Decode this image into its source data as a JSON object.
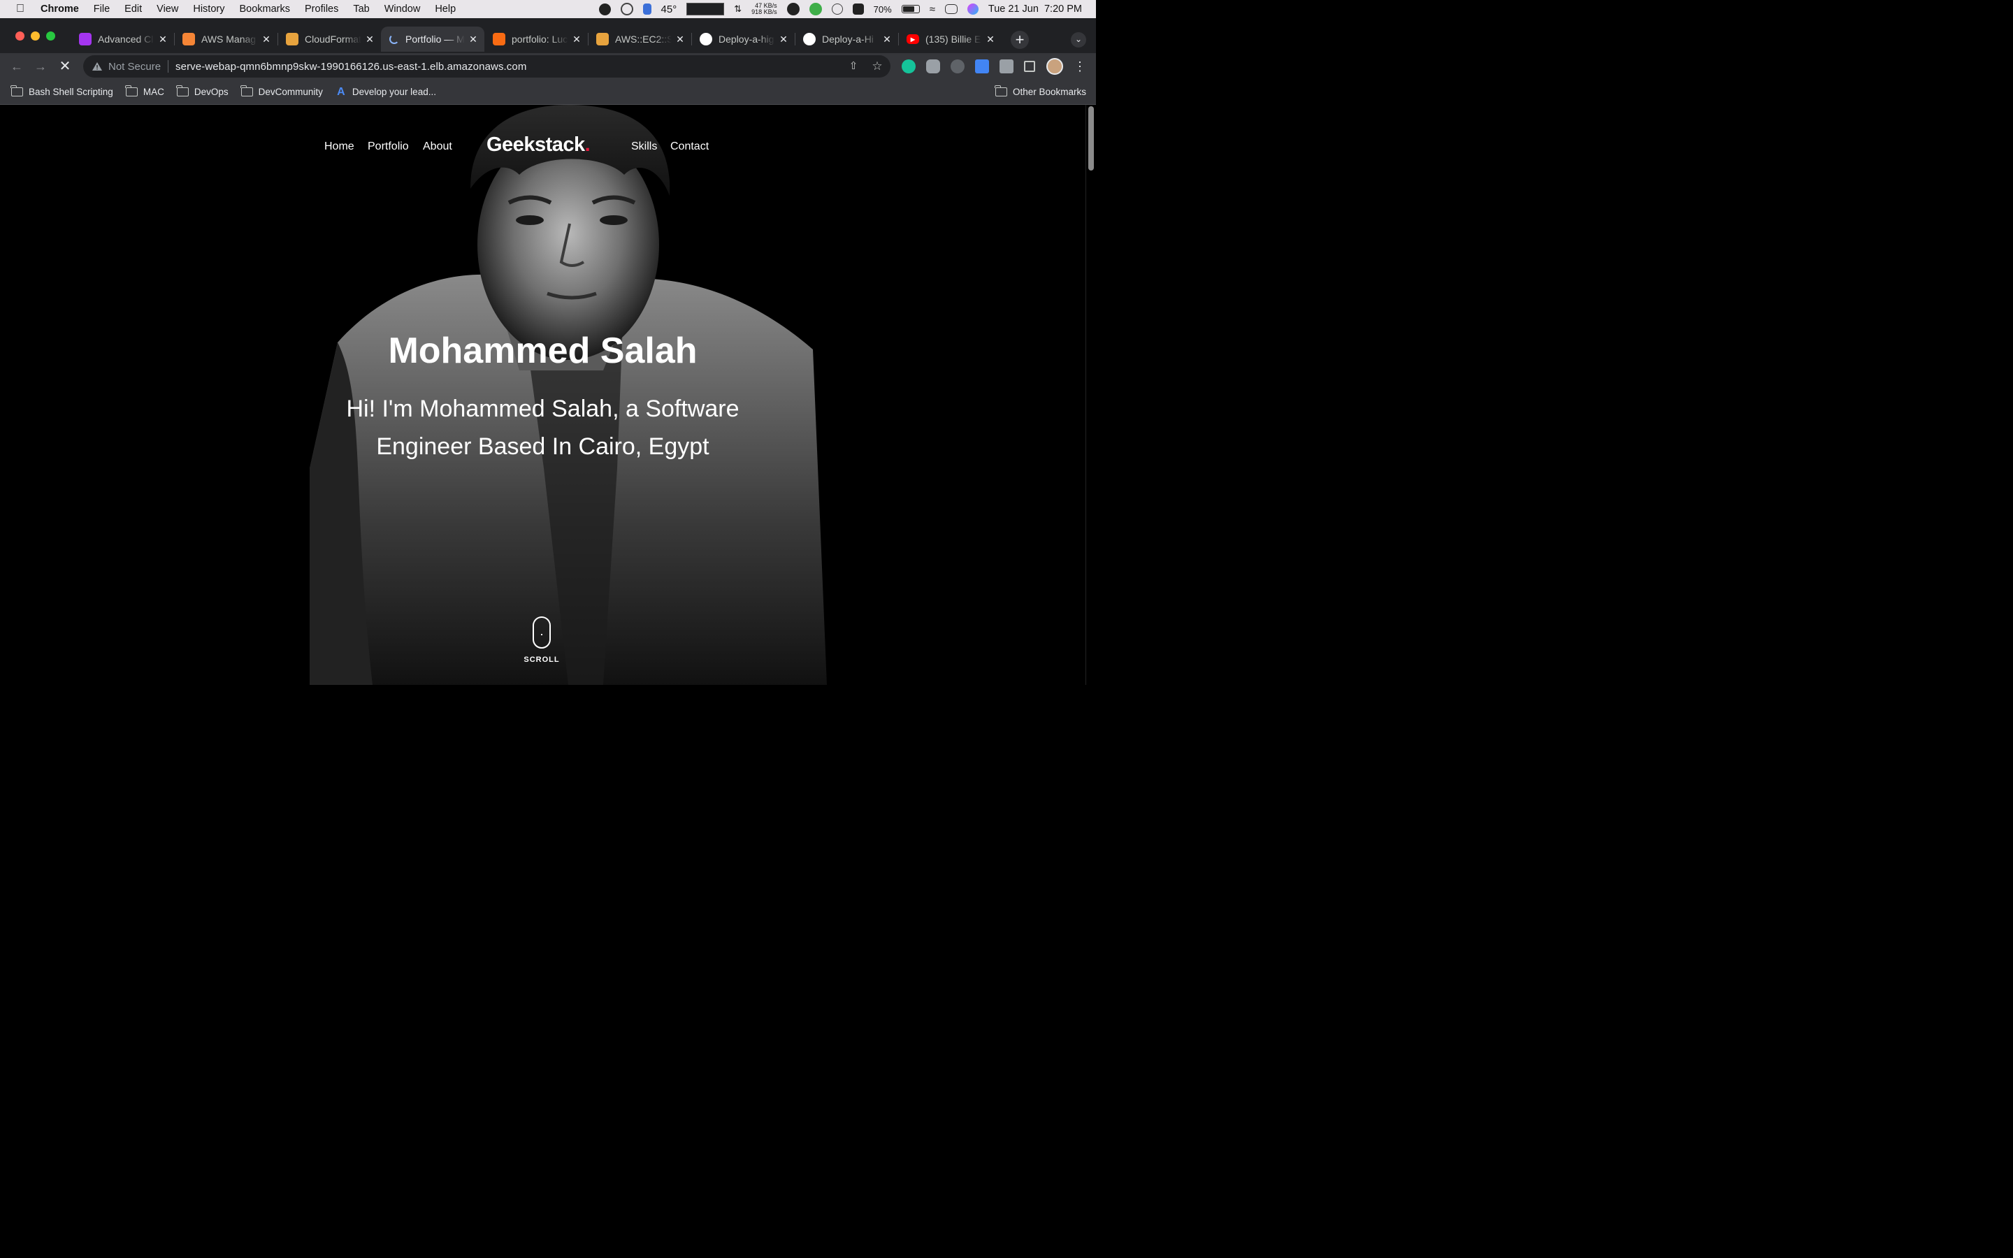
{
  "menubar": {
    "app_name": "Chrome",
    "menus": [
      "File",
      "Edit",
      "View",
      "History",
      "Bookmarks",
      "Profiles",
      "Tab",
      "Window",
      "Help"
    ],
    "temperature": "45°",
    "net_up": "47 KB/s",
    "net_down": "918 KB/s",
    "battery_percent": "70%",
    "battery_level": 0.7,
    "datetime": "Tue 21 Jun  7:20 PM"
  },
  "tabs": [
    {
      "title": "Advanced Cl",
      "icon": "udemy-icon",
      "color": "#a435f0"
    },
    {
      "title": "AWS Manag",
      "icon": "aws-cube-icon",
      "color": "#f58536"
    },
    {
      "title": "CloudFormat",
      "icon": "cloudformation-icon",
      "color": "#e7a33e"
    },
    {
      "title": "Portfolio — M",
      "icon": "loading-icon",
      "color": "#8ab4f8",
      "active": true
    },
    {
      "title": "portfolio: Luc",
      "icon": "lucidchart-icon",
      "color": "#f96b13"
    },
    {
      "title": "AWS::EC2::S",
      "icon": "aws-cube-icon",
      "color": "#e7a33e"
    },
    {
      "title": "Deploy-a-hig",
      "icon": "github-icon",
      "color": "#ffffff"
    },
    {
      "title": "Deploy-a-Hi",
      "icon": "github-icon",
      "color": "#ffffff"
    },
    {
      "title": "(135) Billie E",
      "icon": "youtube-icon",
      "color": "#ff0000"
    }
  ],
  "omnibox": {
    "security": "Not Secure",
    "url": "serve-webap-qmn6bmnp9skw-1990166126.us-east-1.elb.amazonaws.com"
  },
  "bookmarks": {
    "items": [
      "Bash Shell Scripting",
      "MAC",
      "DevOps",
      "DevCommunity"
    ],
    "link": "Develop your lead...",
    "other": "Other Bookmarks"
  },
  "site": {
    "nav_left": [
      "Home",
      "Portfolio",
      "About"
    ],
    "brand": "Geekstack",
    "brand_dot": ".",
    "nav_right": [
      "Skills",
      "Contact"
    ],
    "hero_title": "Mohammed Salah",
    "hero_subtitle": "Hi! I'm Mohammed Salah, a Software Engineer Based In Cairo, Egypt",
    "scroll_label": "SCROLL"
  },
  "colors": {
    "chrome_dark": "#202124",
    "chrome_toolbar": "#35363a",
    "brand_accent": "#e6173b",
    "page_bg": "#000000"
  }
}
